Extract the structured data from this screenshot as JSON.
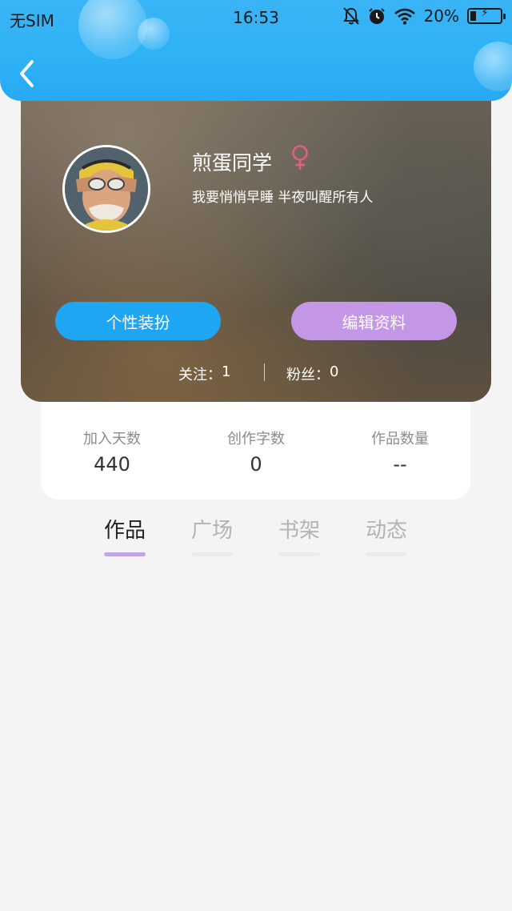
{
  "status_bar": {
    "carrier": "无SIM",
    "time": "16:53",
    "battery": "20%",
    "battery_level": 0.2,
    "icons": [
      "bell-off-icon",
      "alarm-icon",
      "wifi-icon",
      "battery-charging-icon"
    ]
  },
  "nav": {
    "back_icon": "chevron-left-icon"
  },
  "profile": {
    "username": "煎蛋同学",
    "gender_symbol": "♀",
    "bio": "我要悄悄早睡 半夜叫醒所有人",
    "dressup_label": "个性装扮",
    "edit_label": "编辑资料",
    "following_label": "关注：",
    "following_count": "1",
    "fans_label": "粉丝：",
    "fans_count": "0"
  },
  "stats": [
    {
      "label": "加入天数",
      "value": "440"
    },
    {
      "label": "创作字数",
      "value": "0"
    },
    {
      "label": "作品数量",
      "value": "--"
    }
  ],
  "tabs": [
    {
      "label": "作品",
      "active": true
    },
    {
      "label": "广场",
      "active": false
    },
    {
      "label": "书架",
      "active": false
    },
    {
      "label": "动态",
      "active": false
    }
  ],
  "colors": {
    "header": "#2eb2f6",
    "dressup_button": "#1fa6f2",
    "edit_button": "#c497e6",
    "gender": "#e0607e",
    "active_tab_indicator": "#c3a4e6"
  }
}
